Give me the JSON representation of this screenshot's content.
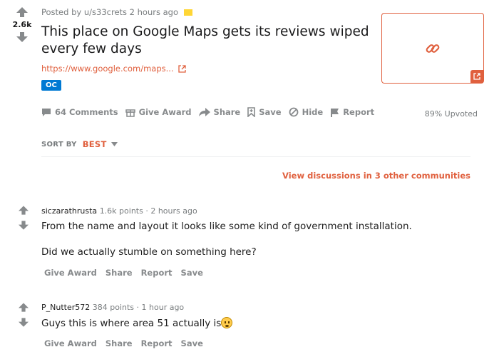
{
  "post": {
    "score": "2.6k",
    "meta": "Posted by u/s33crets 2 hours ago",
    "title": "This place on Google Maps gets its reviews wiped every few days",
    "link": "https://www.google.com/maps...",
    "flair": "OC",
    "upvoted": "89% Upvoted",
    "actions": {
      "comments": "64 Comments",
      "award": "Give Award",
      "share": "Share",
      "save": "Save",
      "hide": "Hide",
      "report": "Report"
    }
  },
  "sort": {
    "label": "SORT BY",
    "value": "BEST"
  },
  "other_discussions": "View discussions in 3 other communities",
  "comments": [
    {
      "author": "siczarathrusta",
      "points": "1.6k points",
      "time": "· 2 hours ago",
      "para1": "From the name and layout it looks like some kind of government installation.",
      "para2": "Did we actually stumble on something here?",
      "actions": [
        "Give Award",
        "Share",
        "Report",
        "Save"
      ]
    },
    {
      "author": "P_Nutter572",
      "points": "384 points",
      "time": "· 1 hour ago",
      "para1": "Guys this is where area 51 actually is",
      "actions": [
        "Give Award",
        "Share",
        "Report",
        "Save"
      ]
    }
  ],
  "colors": {
    "accent": "#e0603e",
    "flair": "#0079d3",
    "muted": "#878a8c"
  }
}
